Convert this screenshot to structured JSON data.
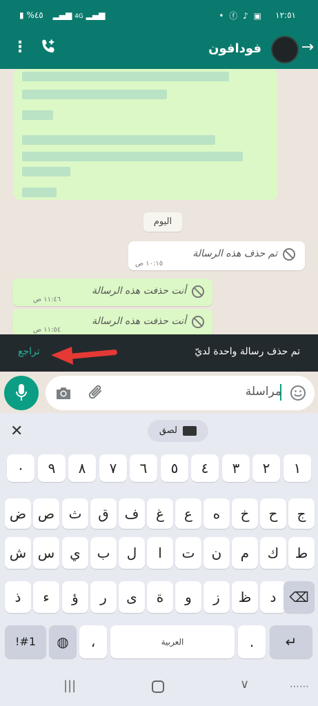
{
  "status_bar": {
    "time": "١٢:٥١",
    "battery": "%٤٥",
    "network": "4G"
  },
  "header": {
    "contact_name": "فودافون"
  },
  "chat": {
    "day_separator": "اليوم",
    "messages": [
      {
        "text": "تم حذف هذه الرسالة",
        "time": "١٠:١٥ ص",
        "direction": "incoming"
      },
      {
        "text": "أنت حذفت هذه الرسالة",
        "time": "١١:٤٦ ص",
        "direction": "outgoing"
      },
      {
        "text": "أنت حذفت هذه الرسالة",
        "time": "١١:٥٤ ص",
        "direction": "outgoing"
      }
    ]
  },
  "snackbar": {
    "message": "تم حذف رسالة واحدة لديّ",
    "action": "تراجع"
  },
  "composer": {
    "placeholder": "مراسلة"
  },
  "keyboard": {
    "paste_label": "لصق",
    "rows": [
      [
        "١",
        "٢",
        "٣",
        "٤",
        "٥",
        "٦",
        "٧",
        "٨",
        "٩",
        "٠"
      ],
      [
        "ض",
        "ص",
        "ث",
        "ق",
        "ف",
        "غ",
        "ع",
        "ه",
        "خ",
        "ح",
        "ج"
      ],
      [
        "ش",
        "س",
        "ي",
        "ب",
        "ل",
        "ا",
        "ت",
        "ن",
        "م",
        "ك",
        "ط"
      ],
      [
        "ذ",
        "ء",
        "ؤ",
        "ر",
        "ى",
        "ة",
        "و",
        "ز",
        "ظ",
        "د"
      ]
    ],
    "symbols_key": "!#1",
    "comma_key": "،",
    "space_label": "العربية",
    "period_key": "."
  },
  "colors": {
    "header_bg": "#0b7a6e",
    "accent": "#0b9e84",
    "snackbar_bg": "#232a2d",
    "bubble_out": "#dcf8c6"
  }
}
